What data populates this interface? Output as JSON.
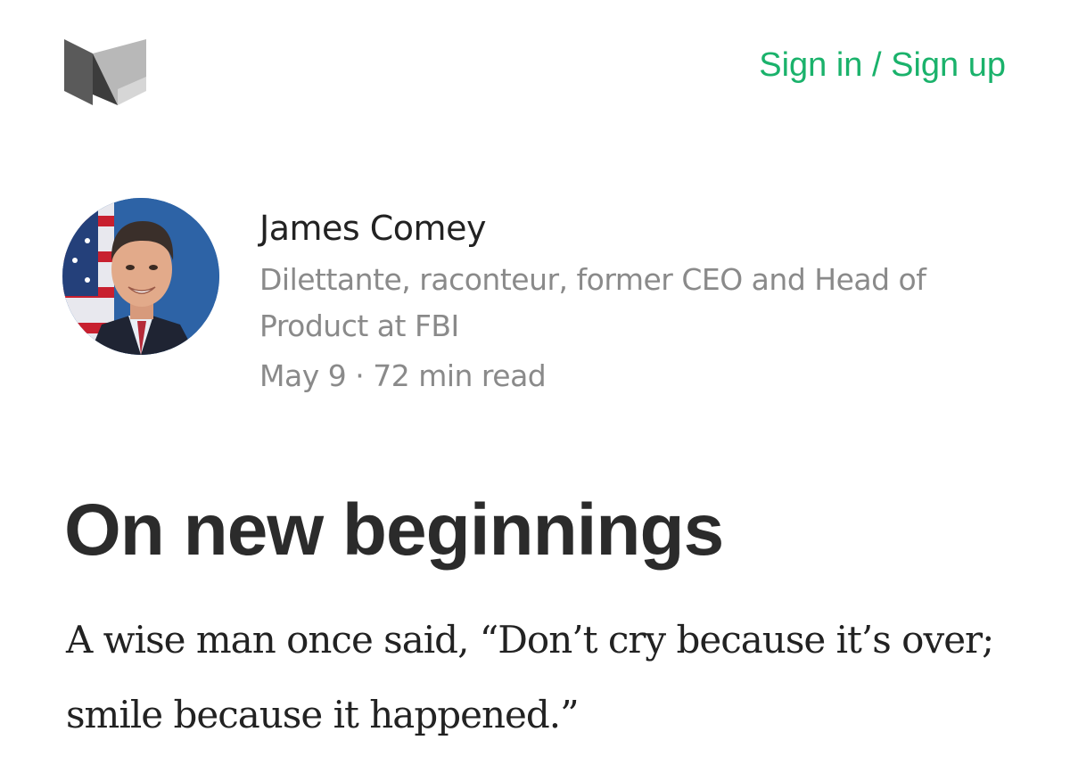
{
  "header": {
    "logo_icon": "medium-m-logo-icon",
    "auth_label": "Sign in / Sign up",
    "accent_color": "#1ab26b"
  },
  "author": {
    "avatar_icon": "author-portrait-avatar",
    "name": "James Comey",
    "bio": "Dilettante, raconteur, former CEO and Head of Product at FBI"
  },
  "meta": {
    "date": "May 9",
    "separator": "·",
    "read_time": "72 min read"
  },
  "article": {
    "title": "On new beginnings",
    "body": "A wise man once said, “Don’t cry because it’s over; smile because it happened.”"
  }
}
